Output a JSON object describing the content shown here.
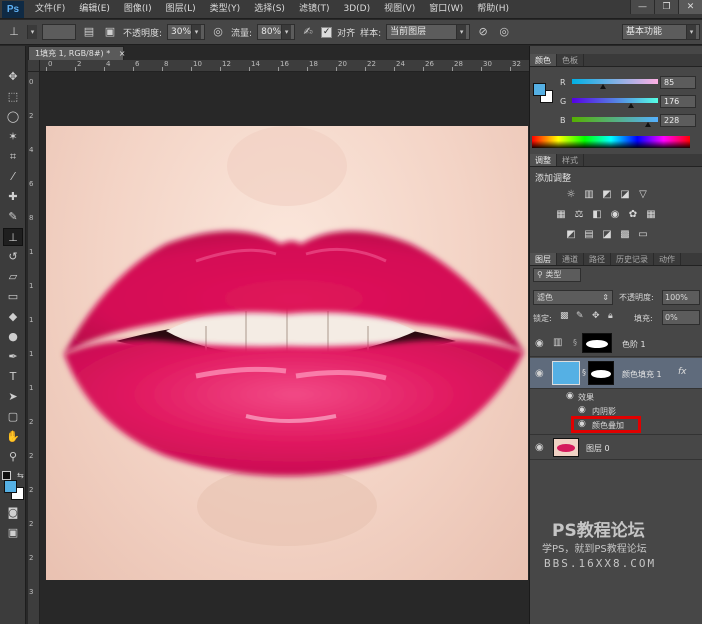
{
  "menubar": {
    "logo": "Ps",
    "items": [
      "文件(F)",
      "编辑(E)",
      "图像(I)",
      "图层(L)",
      "类型(Y)",
      "选择(S)",
      "滤镜(T)",
      "3D(D)",
      "视图(V)",
      "窗口(W)",
      "帮助(H)"
    ],
    "window_buttons": [
      "—",
      "❐",
      "✕"
    ]
  },
  "optbar": {
    "brush_size": "",
    "opacity_label": "不透明度:",
    "opacity_value": "30%",
    "flow_label": "流量:",
    "flow_value": "80%",
    "align_label": "对齐",
    "sample_label": "样本:",
    "sample_value": "当前图层",
    "workspace": "基本功能"
  },
  "document": {
    "tab_title": "1填充 1, RGB/8#) *",
    "close": "×",
    "hruler_labels": [
      "0",
      "2",
      "4",
      "6",
      "8",
      "10",
      "12",
      "14",
      "16",
      "18",
      "20",
      "22",
      "24",
      "26",
      "28",
      "30",
      "32"
    ],
    "vruler_labels": [
      "0",
      "2",
      "4",
      "6",
      "8",
      "1",
      "1",
      "1",
      "1",
      "1",
      "2",
      "2",
      "2",
      "2",
      "2",
      "3"
    ]
  },
  "color_panel": {
    "tabs": [
      "颜色",
      "色板"
    ],
    "r_label": "R",
    "r_value": "85",
    "g_label": "G",
    "g_value": "176",
    "b_label": "B",
    "b_value": "228",
    "fg_color": "#55b0e4"
  },
  "adjustments_panel": {
    "tabs": [
      "调整",
      "样式"
    ],
    "title": "添加调整",
    "icons": [
      "brightness-icon",
      "levels-icon",
      "curves-icon",
      "exposure-icon",
      "vibrance-icon",
      "hue-sat-icon",
      "color-balance-icon",
      "bw-icon",
      "photo-filter-icon",
      "channel-mixer-icon",
      "color-lookup-icon",
      "invert-icon",
      "posterize-icon",
      "threshold-icon",
      "selective-color-icon",
      "gradient-map-icon"
    ]
  },
  "layers_panel": {
    "tabs": [
      "图层",
      "通道",
      "路径",
      "历史记录",
      "动作"
    ],
    "filter_label": "类型",
    "blend_mode": "滤色",
    "opacity_label": "不透明度:",
    "opacity_value": "100%",
    "lock_label": "锁定:",
    "fill_label": "填充:",
    "fill_value": "0%",
    "layers": [
      {
        "name": "色阶 1"
      },
      {
        "name": "颜色填充 1",
        "fx": "fx"
      },
      {
        "name": "图层 0"
      }
    ],
    "effects_label": "效果",
    "effect_inner_shadow": "内阴影",
    "effect_color_overlay": "颜色叠加"
  },
  "watermark": {
    "line1": "PS教程论坛",
    "line2": "学PS，就到PS教程论坛",
    "line3": "BBS.16XX8.COM"
  }
}
